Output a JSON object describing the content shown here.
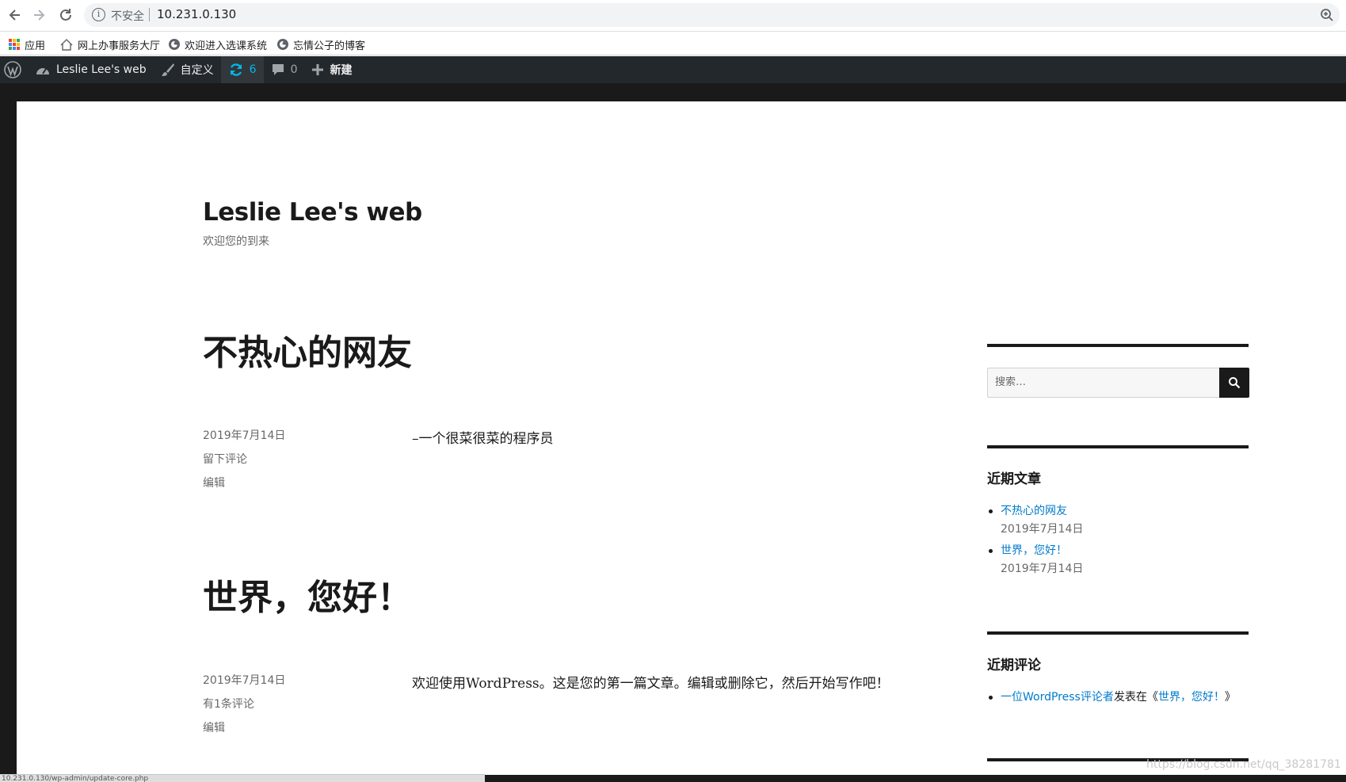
{
  "browser": {
    "security_label": "不安全",
    "url": "10.231.0.130",
    "bookmarks": [
      {
        "label": "应用",
        "icon": "apps-grid-icon"
      },
      {
        "label": "网上办事服务大厅",
        "icon": "home-icon"
      },
      {
        "label": "欢迎进入选课系统",
        "icon": "globe-icon"
      },
      {
        "label": "忘情公子的博客",
        "icon": "globe-icon"
      }
    ],
    "status_url": "10.231.0.130/wp-admin/update-core.php"
  },
  "adminbar": {
    "site_name": "Leslie Lee's web",
    "customize": "自定义",
    "updates_count": "6",
    "comments_count": "0",
    "new_label": "新建",
    "accent": "#00b9eb",
    "background": "#23282d"
  },
  "site": {
    "title": "Leslie Lee's web",
    "description": "欢迎您的到来"
  },
  "posts": [
    {
      "title": "不热心的网友",
      "date": "2019年7月14日",
      "comments": "留下评论",
      "edit": "编辑",
      "excerpt": "–一个很菜很菜的程序员"
    },
    {
      "title": "世界，您好！",
      "date": "2019年7月14日",
      "comments": "有1条评论",
      "edit": "编辑",
      "excerpt": "欢迎使用WordPress。这是您的第一篇文章。编辑或删除它，然后开始写作吧！"
    }
  ],
  "sidebar": {
    "search_placeholder": "搜索…",
    "recent_posts_title": "近期文章",
    "recent_posts": [
      {
        "title": "不热心的网友",
        "date": "2019年7月14日"
      },
      {
        "title": "世界，您好！",
        "date": "2019年7月14日"
      }
    ],
    "recent_comments_title": "近期评论",
    "recent_comment": {
      "author": "一位WordPress评论者",
      "connector": "发表在《",
      "post": "世界，您好！",
      "close": "》"
    },
    "link_color": "#007acc"
  },
  "watermark": "https://blog.csdn.net/qq_38281781"
}
